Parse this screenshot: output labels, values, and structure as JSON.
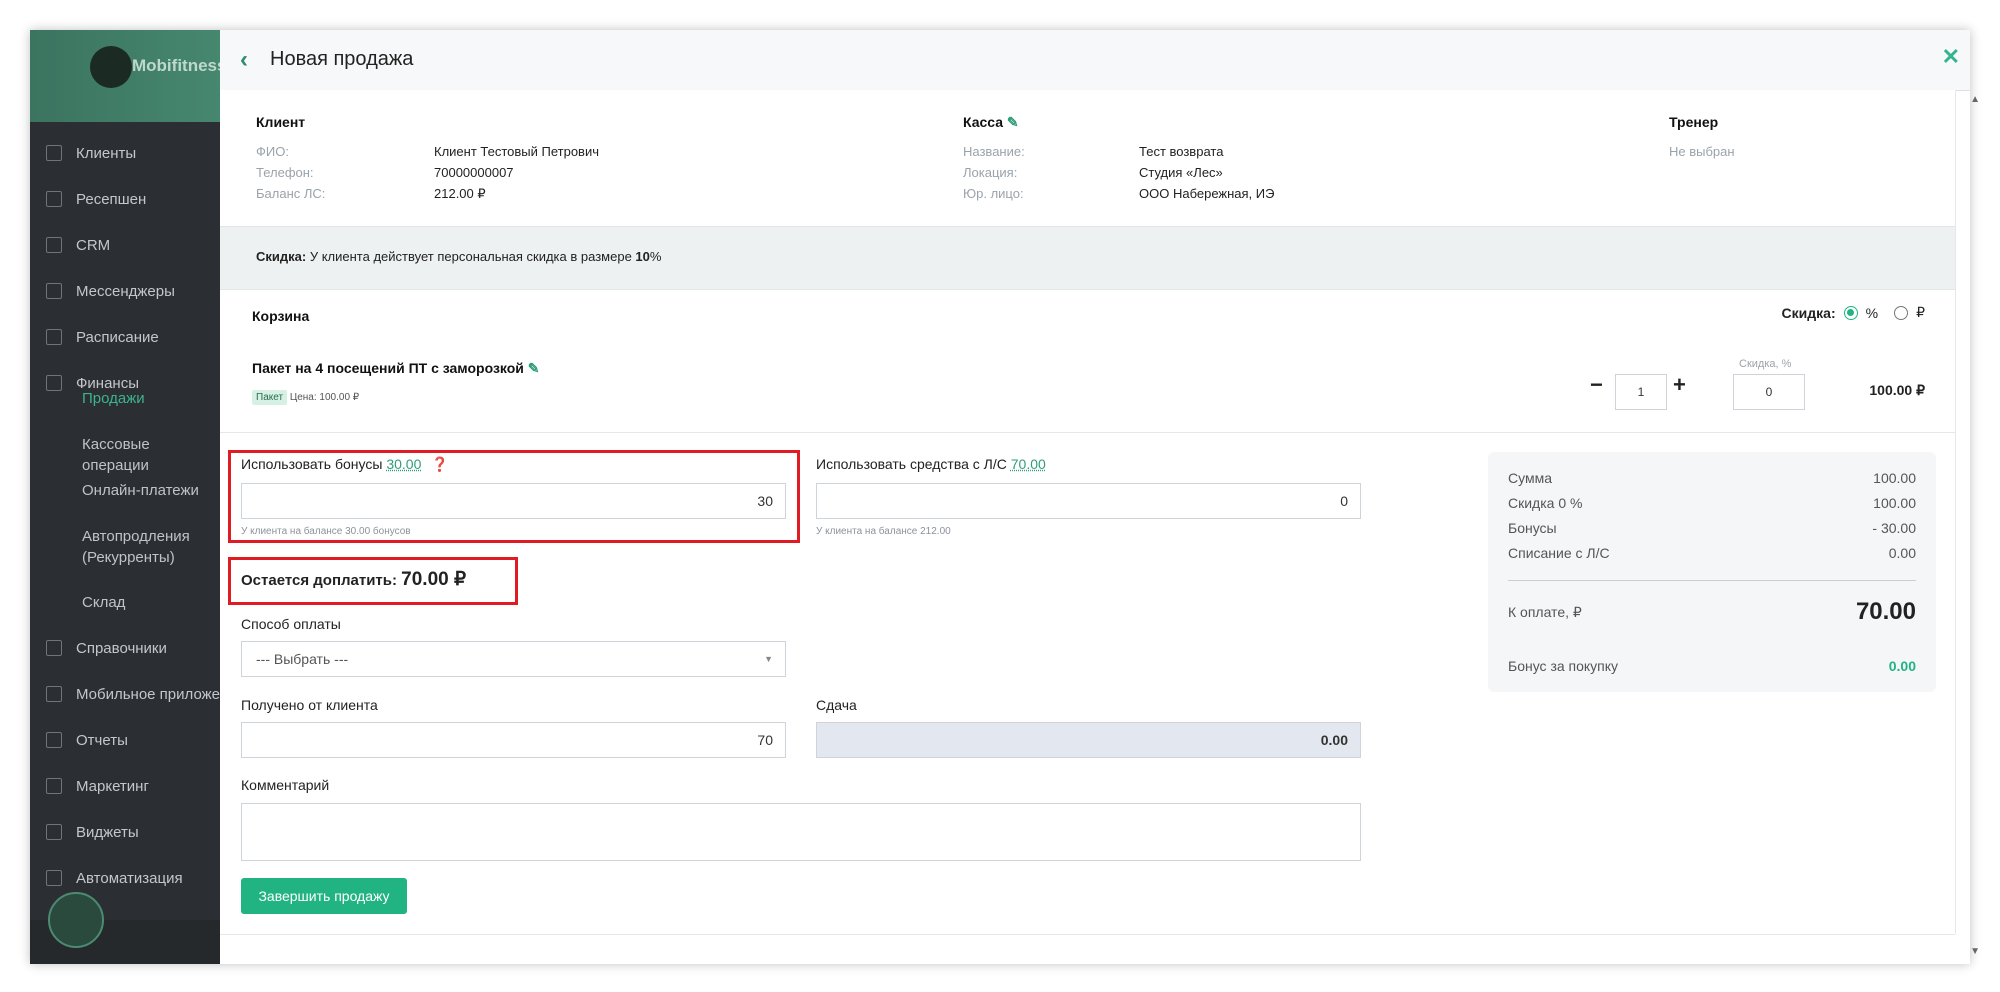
{
  "sidebar": {
    "brand": "Mobifitness",
    "items": [
      {
        "label": "Клиенты",
        "icon": "users-icon"
      },
      {
        "label": "Ресепшен",
        "icon": "clipboard-icon"
      },
      {
        "label": "CRM",
        "icon": "list-icon"
      },
      {
        "label": "Мессенджеры",
        "icon": "chat-icon"
      },
      {
        "label": "Расписание",
        "icon": "calendar-icon"
      },
      {
        "label": "Финансы",
        "icon": "cart-icon"
      },
      {
        "label": "Справочники",
        "icon": "home-icon"
      },
      {
        "label": "Мобильное приложение",
        "icon": "phone-icon"
      },
      {
        "label": "Отчеты",
        "icon": "reports-icon"
      },
      {
        "label": "Маркетинг",
        "icon": "marketing-icon"
      },
      {
        "label": "Виджеты",
        "icon": "widget-icon"
      },
      {
        "label": "Автоматизация",
        "icon": "automation-icon"
      }
    ],
    "finance_sub": [
      "Продажи",
      "Кассовые операции",
      "Онлайн-платежи",
      "Автопродления (Рекурренты)",
      "Склад"
    ]
  },
  "header": {
    "title": "Новая продажа"
  },
  "client": {
    "heading": "Клиент",
    "fio_label": "ФИО:",
    "fio": "Клиент Тестовый Петрович",
    "phone_label": "Телефон:",
    "phone": "70000000007",
    "balance_label": "Баланс ЛС:",
    "balance": "212.00 ₽"
  },
  "kassa": {
    "heading": "Касса",
    "name_label": "Название:",
    "name": "Тест возврата",
    "loc_label": "Локация:",
    "loc": "Студия «Лес»",
    "entity_label": "Юр. лицо:",
    "entity": "ООО Набережная, ИЭ"
  },
  "trainer": {
    "heading": "Тренер",
    "value": "Не выбран"
  },
  "discount_note": {
    "label": "Скидка:",
    "text": "У клиента действует персональная скидка в размере",
    "value": "10",
    "unit": "%"
  },
  "cart": {
    "heading": "Корзина",
    "discount_label": "Скидка:",
    "opt_percent": "%",
    "opt_rub": "₽",
    "item_name": "Пакет на 4 посещений ПТ с заморозкой",
    "item_badge": "Пакет",
    "item_price": "Цена: 100.00 ₽",
    "qty": "1",
    "disc_field_label": "Скидка, %",
    "disc_value": "0",
    "line_total": "100.00 ₽"
  },
  "bonus": {
    "label": "Использовать бонусы",
    "link": "30.00",
    "value": "30",
    "hint": "У клиента на балансе 30.00 бонусов"
  },
  "ls": {
    "label": "Использовать средства с Л/С",
    "link": "70.00",
    "value": "0",
    "hint": "У клиента на балансе 212.00"
  },
  "remaining": {
    "label": "Остается доплатить:",
    "value": "70.00 ₽"
  },
  "payment": {
    "label": "Способ оплаты",
    "value": "--- Выбрать ---"
  },
  "received": {
    "label": "Получено от клиента",
    "value": "70"
  },
  "change": {
    "label": "Сдача",
    "value": "0.00"
  },
  "comment": {
    "label": "Комментарий",
    "value": ""
  },
  "summary": {
    "rows": [
      {
        "label": "Сумма",
        "value": "100.00"
      },
      {
        "label": "Скидка 0 %",
        "value": "100.00"
      },
      {
        "label": "Бонусы",
        "value": "- 30.00"
      },
      {
        "label": "Списание с Л/С",
        "value": "0.00"
      }
    ],
    "pay_label": "К оплате, ₽",
    "pay_value": "70.00",
    "bonus_label": "Бонус за покупку",
    "bonus_value": "0.00"
  },
  "submit_label": "Завершить продажу",
  "colors": {
    "accent": "#22b382",
    "highlight": "#e01b24",
    "sidebar": "#2b2f33"
  }
}
